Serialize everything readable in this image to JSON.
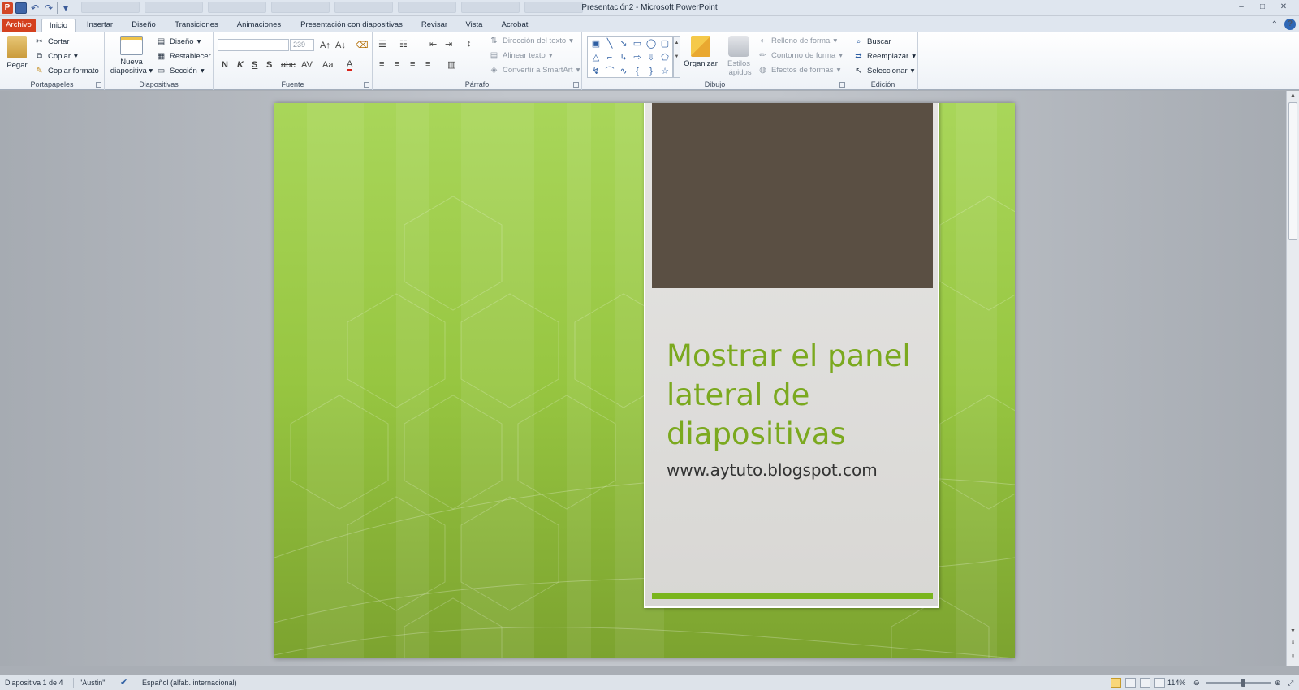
{
  "window": {
    "title": "Presentación2 - Microsoft PowerPoint",
    "controls": {
      "minimize": "‒",
      "maximize": "□",
      "close": "✕"
    }
  },
  "qat": {
    "app_icon_letter": "P"
  },
  "tabs": {
    "file": "Archivo",
    "items": [
      "Inicio",
      "Insertar",
      "Diseño",
      "Transiciones",
      "Animaciones",
      "Presentación con diapositivas",
      "Revisar",
      "Vista",
      "Acrobat"
    ],
    "active": "Inicio"
  },
  "ribbon": {
    "portapapeles": {
      "label": "Portapapeles",
      "paste": "Pegar",
      "cut": "Cortar",
      "copy": "Copiar",
      "format_painter": "Copiar formato"
    },
    "diapositivas": {
      "label": "Diapositivas",
      "new_slide_line1": "Nueva",
      "new_slide_line2": "diapositiva",
      "layout": "Diseño",
      "reset": "Restablecer",
      "section": "Sección"
    },
    "fuente": {
      "label": "Fuente",
      "font_name": "",
      "font_size": "239",
      "bold": "N",
      "italic": "K",
      "underline": "S",
      "shadow": "S",
      "strike": "abc",
      "spacing": "AV",
      "case": "Aa",
      "color": "A"
    },
    "parrafo": {
      "label": "Párrafo",
      "text_direction": "Dirección del texto",
      "align_text": "Alinear texto",
      "smartart": "Convertir a SmartArt"
    },
    "dibujo": {
      "label": "Dibujo",
      "arrange": "Organizar",
      "quick_styles_line1": "Estilos",
      "quick_styles_line2": "rápidos",
      "fill": "Relleno de forma",
      "outline": "Contorno de forma",
      "effects": "Efectos de formas"
    },
    "edicion": {
      "label": "Edición",
      "find": "Buscar",
      "replace": "Reemplazar",
      "select": "Seleccionar"
    }
  },
  "slide": {
    "title": "Mostrar el panel lateral de diapositivas",
    "subtitle": "www.aytuto.blogspot.com"
  },
  "statusbar": {
    "slide_info": "Diapositiva 1 de 4",
    "theme": "\"Austin\"",
    "language": "Español (alfab. internacional)",
    "zoom": "114%",
    "zoom_level": 0.57
  },
  "colors": {
    "file_tab": "#d4411f",
    "slide_green": "#97c641",
    "title_green": "#7ba91f",
    "panel_image": "#5a4f43",
    "accent_bar": "#7ab51d"
  }
}
